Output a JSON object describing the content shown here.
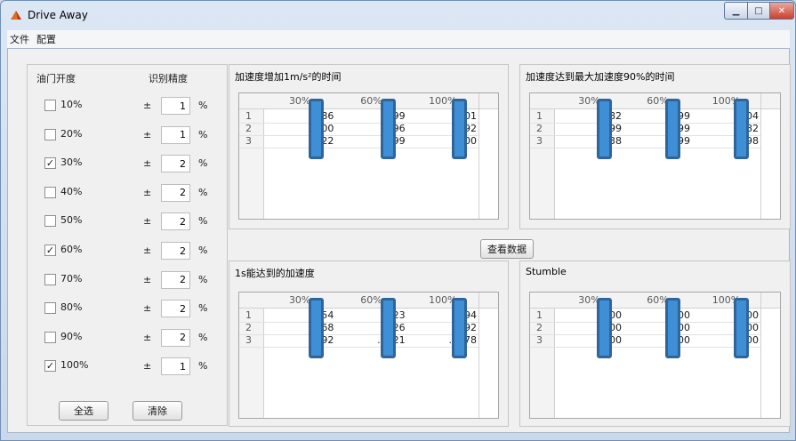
{
  "window": {
    "title": "Drive Away"
  },
  "menu": [
    "文件",
    "配置"
  ],
  "left_panel": {
    "header_throttle": "油门开度",
    "header_precision": "识别精度",
    "plusminus": "±",
    "percent": "%",
    "rows": [
      {
        "label": "10%",
        "checked": false,
        "value": "1"
      },
      {
        "label": "20%",
        "checked": false,
        "value": "1"
      },
      {
        "label": "30%",
        "checked": true,
        "value": "2"
      },
      {
        "label": "40%",
        "checked": false,
        "value": "2"
      },
      {
        "label": "50%",
        "checked": false,
        "value": "2"
      },
      {
        "label": "60%",
        "checked": true,
        "value": "2"
      },
      {
        "label": "70%",
        "checked": false,
        "value": "2"
      },
      {
        "label": "80%",
        "checked": false,
        "value": "2"
      },
      {
        "label": "90%",
        "checked": false,
        "value": "2"
      },
      {
        "label": "100%",
        "checked": true,
        "value": "1"
      }
    ],
    "select_all": "全选",
    "clear": "清除"
  },
  "view_data_button": "查看数据",
  "tables": [
    {
      "title": "加速度增加1m/s²的时间",
      "columns": [
        "30%",
        "60%",
        "100%"
      ],
      "row_numbers": [
        "1",
        "2",
        "3"
      ],
      "rows": [
        [
          "86",
          "399",
          "401"
        ],
        [
          "00",
          "596",
          "992"
        ],
        [
          "22",
          "199",
          "600"
        ]
      ]
    },
    {
      "title": "加速度达到最大加速度90%的时间",
      "columns": [
        "30%",
        "60%",
        "100%"
      ],
      "row_numbers": [
        "1",
        "2",
        "3"
      ],
      "rows": [
        [
          "82",
          "799",
          "204"
        ],
        [
          "99",
          "399",
          "982"
        ],
        [
          "38",
          "199",
          "398"
        ]
      ]
    },
    {
      "title": "1s能达到的加速度",
      "columns": [
        "30%",
        "60%",
        "100%"
      ],
      "row_numbers": [
        "1",
        "2",
        "3"
      ],
      "rows": [
        [
          "54",
          "623",
          "494"
        ],
        [
          "68",
          "426",
          "692"
        ],
        [
          "...92",
          "...721",
          "...278"
        ]
      ]
    },
    {
      "title": "Stumble",
      "columns": [
        "30%",
        "60%",
        "100%"
      ],
      "row_numbers": [
        "1",
        "2",
        "3"
      ],
      "rows": [
        [
          "00",
          "500",
          "400"
        ],
        [
          "00",
          "300",
          "700"
        ],
        [
          "00",
          "300",
          "300"
        ]
      ]
    }
  ],
  "colors": {
    "marker_fill": "#3f8fd6",
    "marker_border": "#2f6599",
    "titlebar": "#dce7f4"
  },
  "icons": {
    "app": "matlab-icon",
    "minimize": "minimize-icon",
    "maximize": "maximize-icon",
    "close": "close-icon"
  }
}
